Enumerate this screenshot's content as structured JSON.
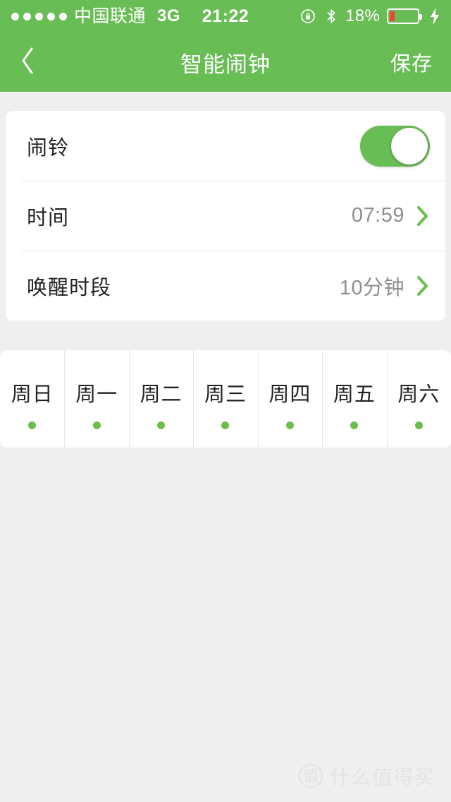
{
  "status_bar": {
    "signal_dots": 5,
    "carrier": "中国联通",
    "network": "3G",
    "time": "21:22",
    "rotation_lock_icon": "rotation-lock-icon",
    "bluetooth_icon": "bluetooth-icon",
    "battery_percent": "18%",
    "battery_level": 18,
    "battery_color": "#f0433a",
    "charging_icon": "lightning-bolt-icon"
  },
  "nav_bar": {
    "back_icon": "chevron-left-icon",
    "title": "智能闹钟",
    "save_label": "保存"
  },
  "theme": {
    "accent": "#69bd55",
    "dot": "#6abf4b",
    "background": "#efefef",
    "value_text": "#8e8e8e"
  },
  "settings": {
    "rows": [
      {
        "label": "闹铃",
        "control": "toggle",
        "toggle_on": true
      },
      {
        "label": "时间",
        "control": "disclosure",
        "value": "07:59",
        "chevron_icon": "chevron-right-icon"
      },
      {
        "label": "唤醒时段",
        "control": "disclosure",
        "value": "10分钟",
        "chevron_icon": "chevron-right-icon"
      }
    ]
  },
  "weekdays": [
    {
      "label": "周日",
      "selected": true
    },
    {
      "label": "周一",
      "selected": true
    },
    {
      "label": "周二",
      "selected": true
    },
    {
      "label": "周三",
      "selected": true
    },
    {
      "label": "周四",
      "selected": true
    },
    {
      "label": "周五",
      "selected": true
    },
    {
      "label": "周六",
      "selected": true
    }
  ],
  "watermark": {
    "logo_text": "值",
    "text": "什么值得买"
  }
}
